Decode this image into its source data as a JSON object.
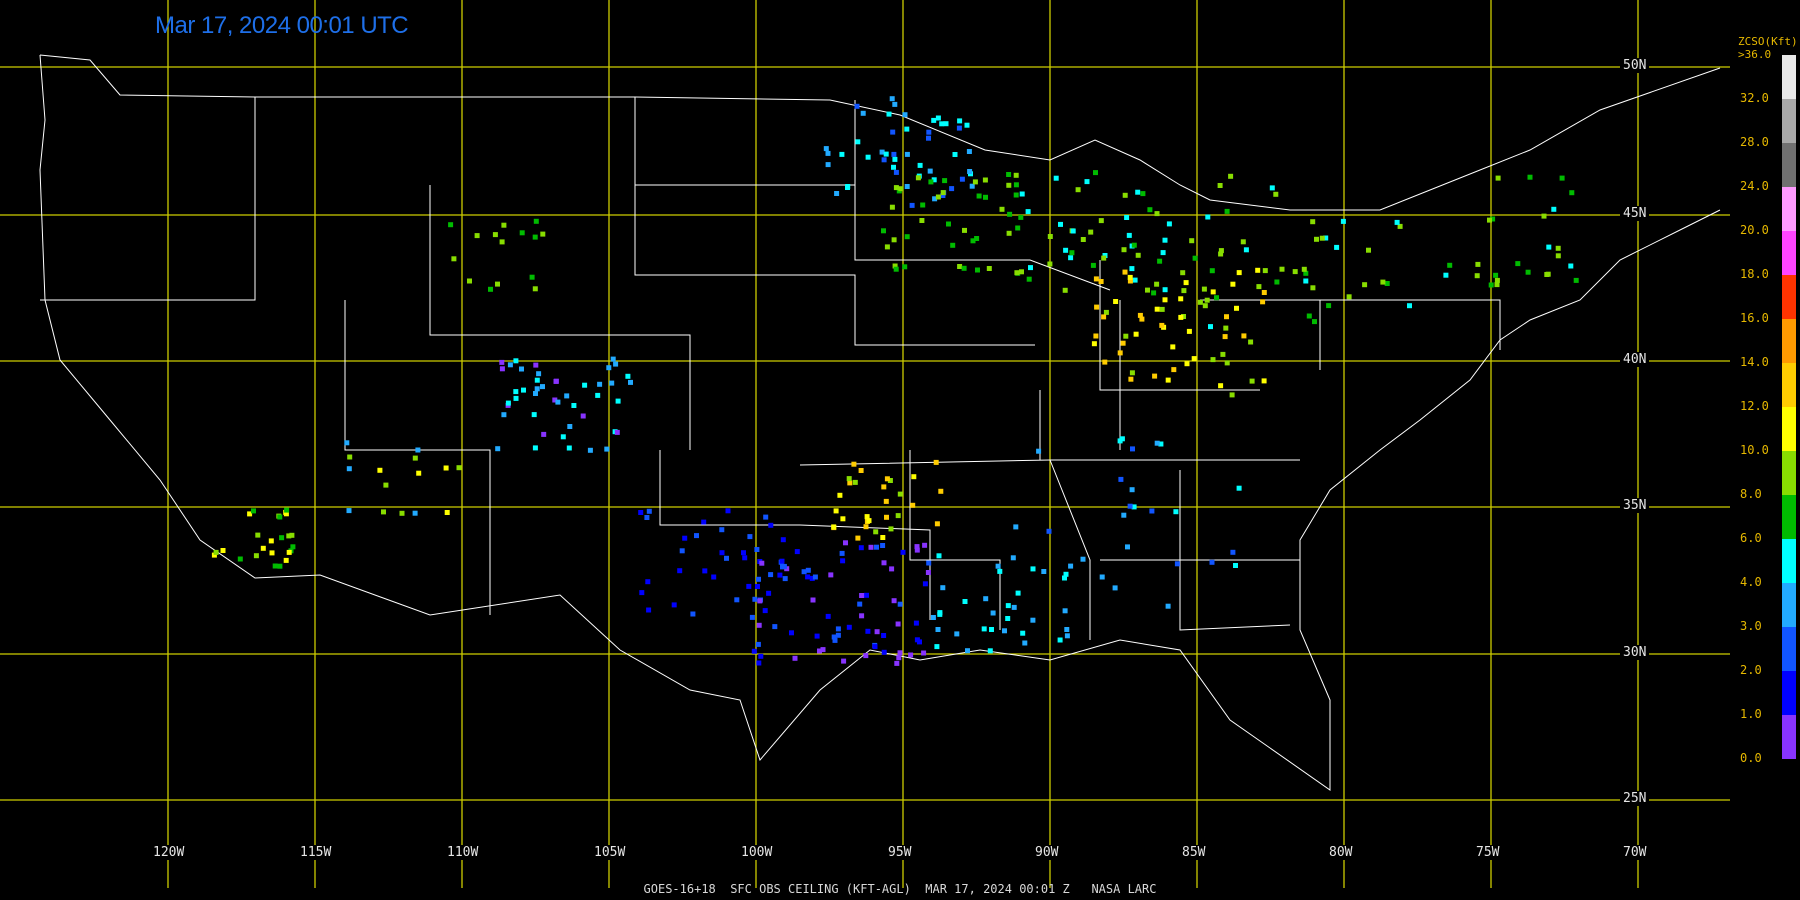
{
  "header": {
    "timestamp": "Mar 17, 2024 00:01 UTC"
  },
  "footer": {
    "caption": "GOES-16+18  SFC OBS CEILING (KFT-AGL)  MAR 17, 2024 00:01 Z   NASA LARC"
  },
  "colorbar": {
    "title_line1": "ZCSO(Kft)",
    "title_line2": ">36.0",
    "labels": [
      "32.0",
      "28.0",
      "24.0",
      "20.0",
      "18.0",
      "16.0",
      "14.0",
      "12.0",
      "10.0",
      "8.0",
      "6.0",
      "4.0",
      "3.0",
      "2.0",
      "1.0",
      "0.0"
    ],
    "colors": [
      "#e8e8e8",
      "#a8a8a8",
      "#707070",
      "#ff99ff",
      "#ff44ff",
      "#ff3300",
      "#ff9900",
      "#ffcc00",
      "#ffff00",
      "#88dd00",
      "#00bb00",
      "#00ffff",
      "#22aaff",
      "#1155ff",
      "#0000ff",
      "#8833ff"
    ]
  },
  "grid": {
    "lat_labels": [
      "50N",
      "45N",
      "40N",
      "35N",
      "30N",
      "25N"
    ],
    "lon_labels": [
      "120W",
      "115W",
      "110W",
      "105W",
      "100W",
      "95W",
      "90W",
      "85W",
      "80W",
      "75W",
      "70W"
    ]
  },
  "colors": {
    "grid": "#cccc00",
    "borders": "#ffffff",
    "background": "#000000"
  }
}
